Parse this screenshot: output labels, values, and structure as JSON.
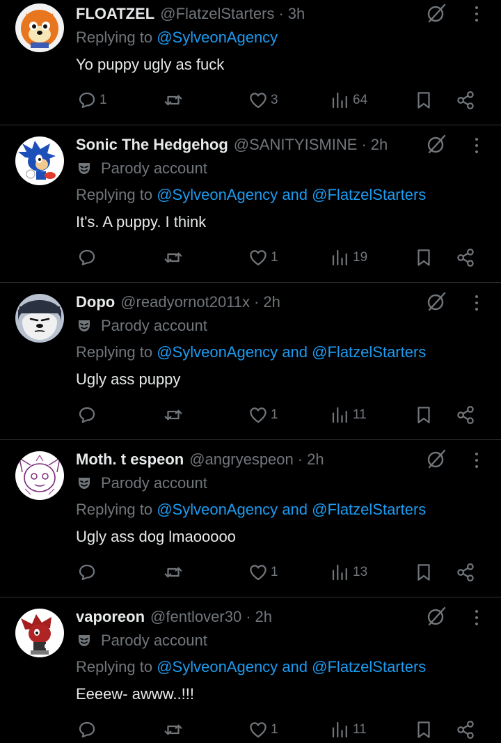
{
  "colors": {
    "background": "#000000",
    "primary_text": "#e7e9ea",
    "secondary_text": "#71767b",
    "link": "#1d9bf0",
    "divider": "#2f3336"
  },
  "icons": {
    "reply": "speech-bubble-icon",
    "repost": "repost-arrows-icon",
    "like": "heart-icon",
    "views": "bar-chart-icon",
    "bookmark": "bookmark-icon",
    "share": "share-icon",
    "grok": "grok-slash-circle-icon",
    "more": "three-dots-vertical-icon",
    "parody": "theater-mask-icon"
  },
  "replying_prefix": "Replying to",
  "and_word": "and",
  "separator": "·",
  "tweets": [
    {
      "name": "FLOATZEL",
      "handle": "@FlatzelStarters",
      "time": "3h",
      "parody_label": "",
      "mentions": [
        "@SylveonAgency"
      ],
      "text": "Yo puppy ugly as fuck",
      "replies": "1",
      "reposts": "",
      "likes": "3",
      "views": "64"
    },
    {
      "name": "Sonic The Hedgehog",
      "handle": "@SANITYISMINE",
      "time": "2h",
      "parody_label": "Parody account",
      "mentions": [
        "@SylveonAgency",
        "@FlatzelStarters"
      ],
      "text": "It's. A puppy. I think",
      "replies": "",
      "reposts": "",
      "likes": "1",
      "views": "19"
    },
    {
      "name": "Dopo",
      "handle": "@readyornot2011x",
      "time": "2h",
      "parody_label": "Parody account",
      "mentions": [
        "@SylveonAgency",
        "@FlatzelStarters"
      ],
      "text": "Ugly ass puppy",
      "replies": "",
      "reposts": "",
      "likes": "1",
      "views": "11"
    },
    {
      "name": "Moth. t espeon",
      "handle": "@angryespeon",
      "time": "2h",
      "parody_label": "Parody account",
      "mentions": [
        "@SylveonAgency",
        "@FlatzelStarters"
      ],
      "text": "Ugly ass dog lmaooooo",
      "replies": "",
      "reposts": "",
      "likes": "1",
      "views": "13"
    },
    {
      "name": "vaporeon",
      "handle": "@fentlover30",
      "time": "2h",
      "parody_label": "Parody account",
      "mentions": [
        "@SylveonAgency",
        "@FlatzelStarters"
      ],
      "text": "Eeeew- awww..!!!",
      "replies": "",
      "reposts": "",
      "likes": "1",
      "views": "11"
    }
  ]
}
